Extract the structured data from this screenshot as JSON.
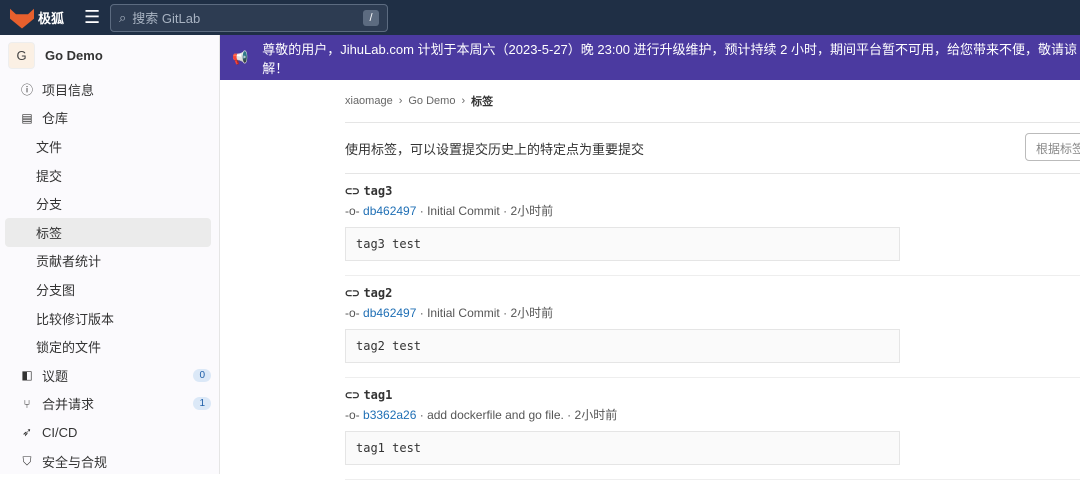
{
  "header": {
    "logo": "极狐",
    "search_placeholder": "搜索 GitLab",
    "shortcut": "/"
  },
  "sidebar": {
    "project_initial": "G",
    "project": "Go Demo",
    "items": [
      {
        "label": "项目信息",
        "icon": "info-icon",
        "sub": false
      },
      {
        "label": "仓库",
        "icon": "repo-icon",
        "sub": false
      },
      {
        "label": "文件",
        "sub": true
      },
      {
        "label": "提交",
        "sub": true
      },
      {
        "label": "分支",
        "sub": true
      },
      {
        "label": "标签",
        "sub": true,
        "active": true
      },
      {
        "label": "贡献者统计",
        "sub": true
      },
      {
        "label": "分支图",
        "sub": true
      },
      {
        "label": "比较修订版本",
        "sub": true
      },
      {
        "label": "锁定的文件",
        "sub": true
      },
      {
        "label": "议题",
        "icon": "issues-icon",
        "badge": "0"
      },
      {
        "label": "合并请求",
        "icon": "merge-icon",
        "badge": "1"
      },
      {
        "label": "CI/CD",
        "icon": "rocket-icon"
      },
      {
        "label": "安全与合规",
        "icon": "shield-icon"
      }
    ]
  },
  "banner": "尊敬的用户，JihuLab.com 计划于本周六（2023-5-27）晚 23:00 进行升级维护，预计持续 2 小时，期间平台暂不可用，给您带来不便，敬请谅解！",
  "breadcrumb": [
    "xiaomage",
    "Go Demo",
    "标签"
  ],
  "description": "使用标签，可以设置提交历史上的特定点为重要提交",
  "filter_placeholder": "根据标签名称过滤",
  "tags": [
    {
      "name": "tag3",
      "sha": "db462497",
      "commit": "Initial Commit",
      "time": "2小时前",
      "message": "tag3 test"
    },
    {
      "name": "tag2",
      "sha": "db462497",
      "commit": "Initial Commit",
      "time": "2小时前",
      "message": "tag2 test"
    },
    {
      "name": "tag1",
      "sha": "b3362a26",
      "commit": "add dockerfile and go file.",
      "time": "2小时前",
      "message": "tag1 test"
    }
  ]
}
